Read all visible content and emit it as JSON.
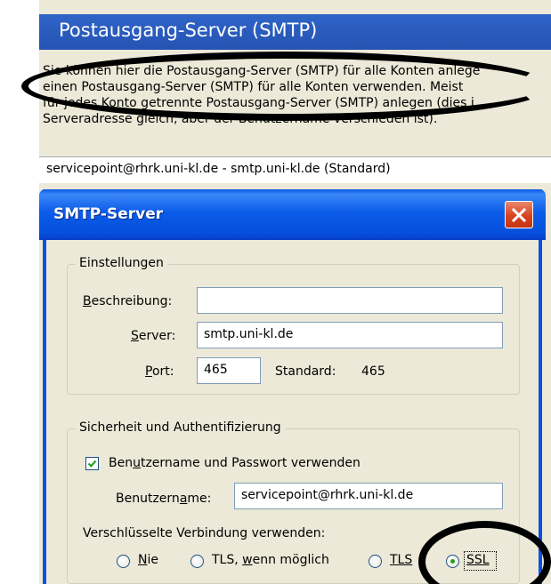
{
  "background": {
    "title": "Postausgang-Server (SMTP)",
    "description_lines": [
      "Sie können hier die Postausgang-Server (SMTP) für alle Konten anlege",
      "einen Postausgang-Server (SMTP) für alle Konten verwenden. Meist",
      "für jedes Konto getrennte Postausgang-Server (SMTP) anlegen (dies i",
      "Serveradresse gleich, aber der Benutzername verschieden ist)."
    ],
    "server_list": [
      "servicepoint@rhrk.uni-kl.de - smtp.uni-kl.de (Standard)"
    ]
  },
  "dialog": {
    "title": "SMTP-Server",
    "settings": {
      "legend": "Einstellungen",
      "description_label_u": "B",
      "description_label_rest": "eschreibung:",
      "description_value": "",
      "server_label_u": "S",
      "server_label_rest": "erver:",
      "server_value": "smtp.uni-kl.de",
      "port_label_u": "P",
      "port_label_rest": "ort:",
      "port_value": "465",
      "default_label": "Standard:",
      "default_value": "465"
    },
    "security": {
      "legend": "Sicherheit und Authentifizierung",
      "use_auth_checked": true,
      "use_auth_pre": "Ben",
      "use_auth_u": "u",
      "use_auth_post": "tzername und Passwort verwenden",
      "username_label_pre": "Benutzern",
      "username_label_u": "a",
      "username_label_post": "me:",
      "username_value": "servicepoint@rhrk.uni-kl.de",
      "encryption_label": "Verschlüsselte Verbindung verwenden:",
      "encryption_options": [
        {
          "pre": "",
          "u": "N",
          "post": "ie",
          "checked": false
        },
        {
          "pre": "TLS, ",
          "u": "w",
          "post": "enn möglich",
          "checked": false
        },
        {
          "pre": "",
          "u": "TLS",
          "post": "",
          "checked": false
        },
        {
          "pre": "",
          "u": "SSL",
          "post": "",
          "checked": true
        }
      ]
    }
  },
  "icons": {
    "close": "close-icon",
    "checkmark": "checkmark-icon"
  },
  "colors": {
    "header_blue": "#2553b3",
    "titlebar_blue": "#0550dc",
    "close_red": "#d8431f",
    "dialog_bg": "#ece9d8",
    "radio_selected": "#21a121",
    "annotation": "#000000"
  }
}
